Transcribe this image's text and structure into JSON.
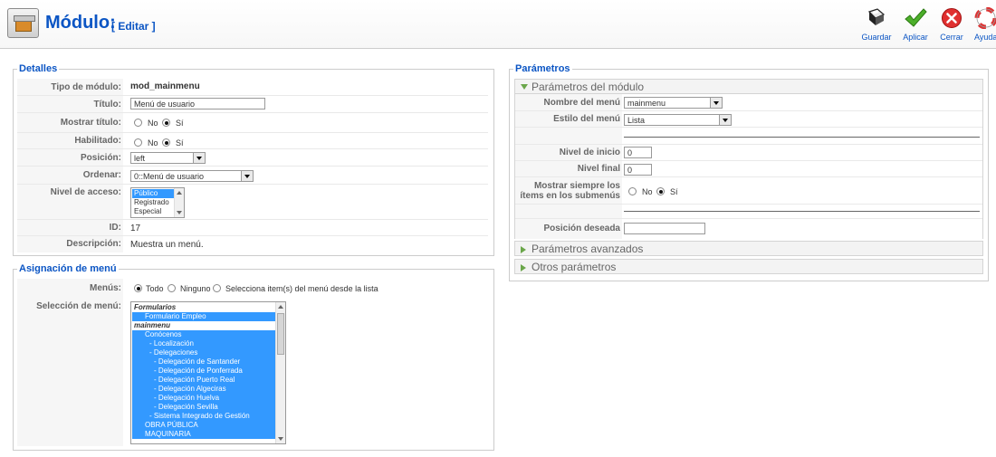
{
  "header": {
    "title": "Módulo:",
    "subtitle": "[ Editar ]",
    "toolbar": {
      "save": "Guardar",
      "apply": "Aplicar",
      "close": "Cerrar",
      "help": "Ayuda"
    }
  },
  "detalles": {
    "legend": "Detalles",
    "tipo_label": "Tipo de módulo:",
    "tipo_value": "mod_mainmenu",
    "titulo_label": "Título:",
    "titulo_value": "Menú de usuario",
    "mostrar_label": "Mostrar título:",
    "habilitado_label": "Habilitado:",
    "no": "No",
    "si": "Sí",
    "posicion_label": "Posición:",
    "posicion_value": "left",
    "ordenar_label": "Ordenar:",
    "ordenar_value": "0::Menú de usuario",
    "nivel_label": "Nivel de acceso:",
    "nivel_options": [
      "Público",
      "Registrado",
      "Especial"
    ],
    "id_label": "ID:",
    "id_value": "17",
    "desc_label": "Descripción:",
    "desc_value": "Muestra un menú."
  },
  "asignacion": {
    "legend": "Asignación de menú",
    "menus_label": "Menús:",
    "todo": "Todo",
    "ninguno": "Ninguno",
    "selecciona": "Selecciona item(s) del menú desde la lista",
    "seleccion_label": "Selección de menú:",
    "items": [
      "Formularios",
      "Formulario Empleo",
      "mainmenu",
      "Conócenos",
      "- Localización",
      "- Delegaciones",
      "- Delegación de Santander",
      "- Delegación de Ponferrada",
      "- Delegación Puerto Real",
      "- Delegación Algeciras",
      "- Delegación Huelva",
      "- Delegación Sevilla",
      "- Sistema Integrado de Gestión",
      "OBRA PÚBLICA",
      "MAQUINARIA"
    ]
  },
  "parametros": {
    "legend": "Parámetros",
    "modulo_panel": "Parámetros del módulo",
    "nombre_label": "Nombre del menú",
    "nombre_value": "mainmenu",
    "estilo_label": "Estilo del menú",
    "estilo_value": "Lista",
    "nivel_inicio_label": "Nivel de inicio",
    "nivel_inicio_value": "0",
    "nivel_final_label": "Nivel final",
    "nivel_final_value": "0",
    "mostrar_sub_label_1": "Mostrar siempre los",
    "mostrar_sub_label_2": "ítems en los submenús",
    "no": "No",
    "si": "Sí",
    "posicion_label": "Posición deseada",
    "posicion_value": "",
    "avanzados_panel": "Parámetros avanzados",
    "otros_panel": "Otros parámetros"
  }
}
